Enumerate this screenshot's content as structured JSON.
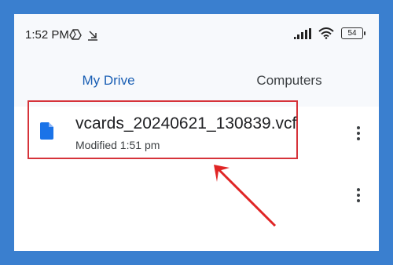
{
  "status_bar": {
    "time": "1:52 PM",
    "battery": "54",
    "icons": [
      "drive-sync-icon",
      "download-icon",
      "signal-icon",
      "wifi-icon",
      "battery-icon"
    ]
  },
  "tabs": [
    {
      "label": "My Drive",
      "selected": true
    },
    {
      "label": "Computers",
      "selected": false
    }
  ],
  "files": [
    {
      "name": "vcards_20240621_130839.vcf",
      "modified": "Modified 1:51 pm",
      "icon": "document-icon"
    }
  ],
  "colors": {
    "background": "#3a7fcf",
    "accent": "#1a5fb4",
    "file_icon": "#1a73e8",
    "highlight": "#d6333a"
  }
}
